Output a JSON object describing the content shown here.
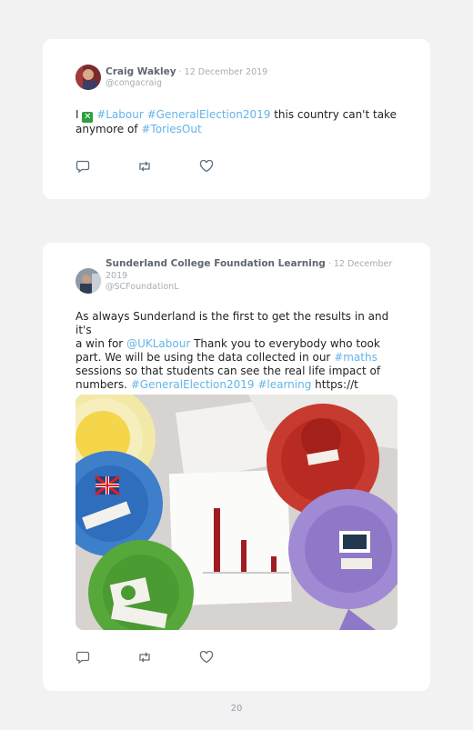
{
  "tweets": [
    {
      "name": "Craig Wakley",
      "date": " · 12 December 2019",
      "handle": "@congacraig",
      "text_parts": [
        "I ",
        "#Labour",
        " ",
        "#GeneralElection2019",
        " this country can't take",
        "anymore of ",
        "#ToriesOut"
      ]
    },
    {
      "name": "Sunderland College Foundation Learning",
      "date_a": " · 12 December",
      "date_b": "2019",
      "handle": "@SCFoundationL",
      "lines": [
        "As always Sunderland is the first to get the results in and it's",
        "a win for ",
        "@UKLabour",
        " Thank you to everybody who took",
        "part. We will be using the data collected in our ",
        "#maths",
        "sessions so that students can see the real life impact of",
        "numbers. ",
        "#GeneralElection2019",
        " ",
        "#learning",
        " https://t"
      ],
      "photo": {
        "rosettes": [
          "Liberal Democrats",
          "Labour",
          "Conservative",
          "BREXIT PARTY",
          "Brexit",
          "Green Party"
        ]
      }
    }
  ],
  "icons": [
    "reply-icon",
    "retweet-icon",
    "like-icon",
    "check-box-icon"
  ],
  "page_number": "20",
  "colors": {
    "link": "#64b4e8",
    "card": "#ffffff",
    "background": "#f2f2f2"
  }
}
